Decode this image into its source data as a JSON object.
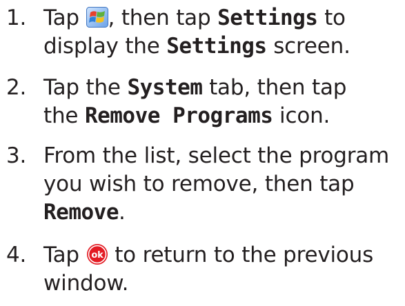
{
  "steps": [
    {
      "number": "1.",
      "lines": [
        {
          "a": "Tap ",
          "icon": "windows-start-icon",
          "b": ", then tap ",
          "kw": "Settings",
          "c": " to"
        },
        {
          "a": "display the ",
          "kw": "Settings",
          "b": " screen."
        }
      ]
    },
    {
      "number": "2.",
      "lines": [
        {
          "a": "Tap the ",
          "kw": "System",
          "b": " tab, then tap"
        },
        {
          "a": "the ",
          "kw": "Remove Programs",
          "b": " icon."
        }
      ]
    },
    {
      "number": "3.",
      "lines": [
        {
          "a": "From the list, select the program"
        },
        {
          "a": "you wish to remove, then tap"
        },
        {
          "kw": "Remove",
          "b": "."
        }
      ]
    },
    {
      "number": "4.",
      "lines": [
        {
          "a": "Tap ",
          "icon": "ok-button-icon",
          "b": " to return to the previous"
        },
        {
          "a": "window."
        }
      ]
    }
  ],
  "colors": {
    "text": "#231f20",
    "ok_red": "#e31b23",
    "flag_red": "#e8412c",
    "flag_green": "#5fb13a",
    "flag_blue": "#2f7fd8",
    "flag_yellow": "#f6c21c"
  }
}
